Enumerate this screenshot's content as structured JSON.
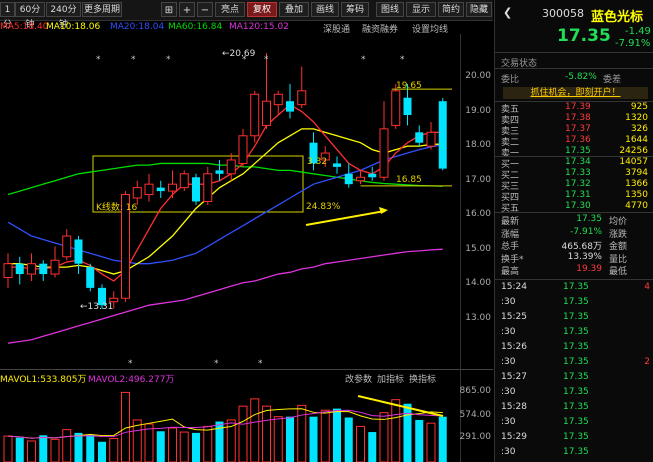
{
  "toolbar": {
    "periods": [
      "1分",
      "60分钟",
      "240分钟",
      "更多周期"
    ],
    "icons": [
      "grid-icon",
      "add-icon",
      "minus-icon",
      "back-icon"
    ],
    "buttons": [
      "亮点",
      "复权",
      "叠加",
      "画线",
      "筹码",
      "图线",
      "显示",
      "简约",
      "隐藏"
    ]
  },
  "ma_legend": {
    "ma5": "MA5:18.40",
    "ma10": "MA10:18.06",
    "ma20": "MA20:18.04",
    "ma60": "MA60:16.84",
    "ma120": "MA120:15.02"
  },
  "subtabs": [
    "深股通",
    "融资融券",
    "设置均线"
  ],
  "colors": {
    "ma5": "#ff3030",
    "ma10": "#ffff00",
    "ma20": "#3050ff",
    "ma60": "#00dd00",
    "ma120": "#dd33dd",
    "up": "#ff3030",
    "down": "#00e5ff"
  },
  "chart_data": {
    "type": "candlestick",
    "price_axis": [
      "20.00",
      "19.00",
      "18.00",
      "17.00",
      "16.00",
      "15.00",
      "14.00",
      "13.00"
    ],
    "annotations": {
      "high": "20.69",
      "low": "13.31",
      "line_high": "19.65",
      "line_low": "16.85",
      "mid": "3.32",
      "pct": "24.83%",
      "kcount": "K线数: 16"
    },
    "candles": [
      {
        "o": 14.2,
        "c": 14.6,
        "h": 14.9,
        "l": 13.9
      },
      {
        "o": 14.6,
        "c": 14.3,
        "h": 14.8,
        "l": 14.0
      },
      {
        "o": 14.3,
        "c": 14.6,
        "h": 14.9,
        "l": 14.1
      },
      {
        "o": 14.6,
        "c": 14.3,
        "h": 14.7,
        "l": 14.1
      },
      {
        "o": 14.3,
        "c": 14.7,
        "h": 15.1,
        "l": 14.2
      },
      {
        "o": 14.8,
        "c": 15.4,
        "h": 15.6,
        "l": 14.7
      },
      {
        "o": 15.3,
        "c": 14.6,
        "h": 15.4,
        "l": 14.3
      },
      {
        "o": 14.5,
        "c": 13.9,
        "h": 14.6,
        "l": 13.8
      },
      {
        "o": 13.9,
        "c": 13.4,
        "h": 14.0,
        "l": 13.3
      },
      {
        "o": 13.5,
        "c": 13.6,
        "h": 13.8,
        "l": 13.3
      },
      {
        "o": 13.6,
        "c": 16.6,
        "h": 16.7,
        "l": 13.5
      },
      {
        "o": 16.5,
        "c": 16.8,
        "h": 17.0,
        "l": 16.3
      },
      {
        "o": 16.6,
        "c": 16.9,
        "h": 17.2,
        "l": 16.4
      },
      {
        "o": 16.8,
        "c": 16.7,
        "h": 17.0,
        "l": 16.5
      },
      {
        "o": 16.7,
        "c": 16.9,
        "h": 17.3,
        "l": 16.5
      },
      {
        "o": 16.8,
        "c": 17.2,
        "h": 17.3,
        "l": 16.7
      },
      {
        "o": 17.1,
        "c": 16.4,
        "h": 17.2,
        "l": 16.3
      },
      {
        "o": 16.4,
        "c": 17.2,
        "h": 17.4,
        "l": 16.3
      },
      {
        "o": 17.3,
        "c": 17.2,
        "h": 17.6,
        "l": 17.0
      },
      {
        "o": 17.2,
        "c": 17.6,
        "h": 17.8,
        "l": 17.0
      },
      {
        "o": 17.5,
        "c": 18.3,
        "h": 18.5,
        "l": 17.4
      },
      {
        "o": 18.3,
        "c": 19.5,
        "h": 19.6,
        "l": 18.1
      },
      {
        "o": 18.6,
        "c": 19.3,
        "h": 20.69,
        "l": 18.5
      },
      {
        "o": 19.2,
        "c": 19.5,
        "h": 19.6,
        "l": 18.9
      },
      {
        "o": 19.3,
        "c": 19.0,
        "h": 19.8,
        "l": 18.8
      },
      {
        "o": 19.2,
        "c": 19.6,
        "h": 20.3,
        "l": 19.1
      },
      {
        "o": 18.1,
        "c": 17.5,
        "h": 18.4,
        "l": 17.3
      },
      {
        "o": 17.6,
        "c": 17.8,
        "h": 18.0,
        "l": 17.4
      },
      {
        "o": 17.5,
        "c": 17.4,
        "h": 17.7,
        "l": 17.2
      },
      {
        "o": 17.2,
        "c": 16.9,
        "h": 17.5,
        "l": 16.8
      },
      {
        "o": 17.0,
        "c": 17.1,
        "h": 17.3,
        "l": 16.9
      },
      {
        "o": 17.2,
        "c": 17.1,
        "h": 17.4,
        "l": 17.0
      },
      {
        "o": 17.1,
        "c": 18.5,
        "h": 19.3,
        "l": 17.0
      },
      {
        "o": 18.6,
        "c": 19.6,
        "h": 19.8,
        "l": 18.5
      },
      {
        "o": 19.4,
        "c": 18.9,
        "h": 19.8,
        "l": 18.6
      },
      {
        "o": 18.4,
        "c": 18.1,
        "h": 18.6,
        "l": 18.0
      },
      {
        "o": 18.0,
        "c": 18.4,
        "h": 18.7,
        "l": 17.9
      },
      {
        "o": 19.3,
        "c": 17.35,
        "h": 19.39,
        "l": 17.3
      }
    ],
    "ma5": [
      14.5,
      14.5,
      14.45,
      14.45,
      14.5,
      14.65,
      14.7,
      14.55,
      14.3,
      14.1,
      14.4,
      15.0,
      15.6,
      16.2,
      16.6,
      16.9,
      16.9,
      16.9,
      17.0,
      17.2,
      17.5,
      18.0,
      18.6,
      18.9,
      19.2,
      19.0,
      18.7,
      18.3,
      17.9,
      17.5,
      17.3,
      17.2,
      17.4,
      17.8,
      18.1,
      18.3,
      18.4,
      18.4
    ],
    "ma10": [
      14.6,
      14.6,
      14.55,
      14.5,
      14.5,
      14.5,
      14.55,
      14.5,
      14.4,
      14.3,
      14.4,
      14.6,
      14.8,
      15.1,
      15.4,
      15.8,
      16.2,
      16.5,
      16.8,
      17.0,
      17.2,
      17.5,
      17.8,
      18.1,
      18.3,
      18.5,
      18.5,
      18.4,
      18.3,
      18.2,
      18.1,
      17.9,
      17.8,
      17.9,
      18.0,
      18.0,
      18.05,
      18.06
    ],
    "ma20": [
      15.8,
      15.6,
      15.4,
      15.3,
      15.2,
      15.1,
      15.0,
      14.9,
      14.8,
      14.7,
      14.65,
      14.6,
      14.6,
      14.65,
      14.7,
      14.8,
      14.9,
      15.1,
      15.3,
      15.5,
      15.7,
      15.9,
      16.1,
      16.3,
      16.5,
      16.7,
      16.9,
      17.0,
      17.1,
      17.2,
      17.3,
      17.45,
      17.6,
      17.7,
      17.8,
      17.9,
      17.98,
      18.04
    ],
    "ma60": [
      16.6,
      16.7,
      16.8,
      16.9,
      17.0,
      17.1,
      17.2,
      17.25,
      17.3,
      17.35,
      17.4,
      17.45,
      17.45,
      17.5,
      17.5,
      17.5,
      17.5,
      17.5,
      17.45,
      17.45,
      17.4,
      17.4,
      17.35,
      17.3,
      17.3,
      17.25,
      17.2,
      17.15,
      17.1,
      17.05,
      17.0,
      16.95,
      16.92,
      16.9,
      16.88,
      16.86,
      16.85,
      16.84
    ],
    "ma120": [
      12.3,
      12.35,
      12.4,
      12.5,
      12.6,
      12.7,
      12.8,
      12.9,
      13.0,
      13.1,
      13.2,
      13.3,
      13.4,
      13.45,
      13.5,
      13.55,
      13.65,
      13.75,
      13.85,
      13.95,
      14.05,
      14.1,
      14.2,
      14.3,
      14.35,
      14.45,
      14.5,
      14.6,
      14.65,
      14.7,
      14.75,
      14.8,
      14.85,
      14.9,
      14.95,
      14.97,
      15.0,
      15.02
    ],
    "volumes": [
      320,
      300,
      260,
      330,
      280,
      400,
      360,
      340,
      250,
      290,
      860,
      520,
      470,
      380,
      420,
      370,
      360,
      440,
      500,
      520,
      690,
      780,
      690,
      560,
      560,
      700,
      560,
      640,
      660,
      550,
      440,
      370,
      610,
      770,
      720,
      520,
      480,
      560
    ],
    "vol_axis": [
      "865.00",
      "574.00",
      "291.00"
    ]
  },
  "vol_legend": {
    "mavol1": "MAVOL1:533.805万",
    "mavol2": "MAVOL2:496.277万"
  },
  "vol_tabs": [
    "改参数",
    "加指标",
    "换指标"
  ],
  "quote": {
    "code": "300058",
    "name": "蓝色光标",
    "price": "17.35",
    "change": "-1.49",
    "change_pct": "-7.91%",
    "status_label": "交易状态",
    "weibi_label": "委比",
    "weibi": "-5.82%",
    "weicha_label": "委差",
    "ad": "抓住机会，即刻开户！"
  },
  "order_book": {
    "asks": [
      {
        "label": "卖五",
        "price": "17.39",
        "vol": "925"
      },
      {
        "label": "卖四",
        "price": "17.38",
        "vol": "1320"
      },
      {
        "label": "卖三",
        "price": "17.37",
        "vol": "326"
      },
      {
        "label": "卖二",
        "price": "17.36",
        "vol": "1644"
      },
      {
        "label": "卖一",
        "price": "17.35",
        "vol": "24256"
      }
    ],
    "bids": [
      {
        "label": "买一",
        "price": "17.34",
        "vol": "14057"
      },
      {
        "label": "买二",
        "price": "17.33",
        "vol": "3794"
      },
      {
        "label": "买三",
        "price": "17.32",
        "vol": "1366"
      },
      {
        "label": "买四",
        "price": "17.31",
        "vol": "1350"
      },
      {
        "label": "买五",
        "price": "17.30",
        "vol": "4770"
      }
    ]
  },
  "stats": [
    {
      "l": "最新",
      "v": "17.35",
      "r": "均价"
    },
    {
      "l": "涨幅",
      "v": "-7.91%",
      "r": "涨跌"
    },
    {
      "l": "总手",
      "v": "465.68万",
      "r": "金额"
    },
    {
      "l": "换手*",
      "v": "13.39%",
      "r": "量比"
    },
    {
      "l": "最高",
      "v": "19.39",
      "r": "最低"
    }
  ],
  "ticks": [
    {
      "t": "15:24",
      "p": "17.35",
      "v": "4"
    },
    {
      "t": ":30",
      "p": "17.35",
      "v": ""
    },
    {
      "t": "15:25",
      "p": "17.35",
      "v": ""
    },
    {
      "t": ":30",
      "p": "17.35",
      "v": ""
    },
    {
      "t": "15:26",
      "p": "17.35",
      "v": ""
    },
    {
      "t": ":30",
      "p": "17.35",
      "v": "2"
    },
    {
      "t": "15:27",
      "p": "17.35",
      "v": ""
    },
    {
      "t": ":30",
      "p": "17.35",
      "v": ""
    },
    {
      "t": "15:28",
      "p": "17.35",
      "v": ""
    },
    {
      "t": ":30",
      "p": "17.35",
      "v": ""
    },
    {
      "t": "15:29",
      "p": "17.35",
      "v": ""
    },
    {
      "t": ":30",
      "p": "17.35",
      "v": ""
    }
  ]
}
